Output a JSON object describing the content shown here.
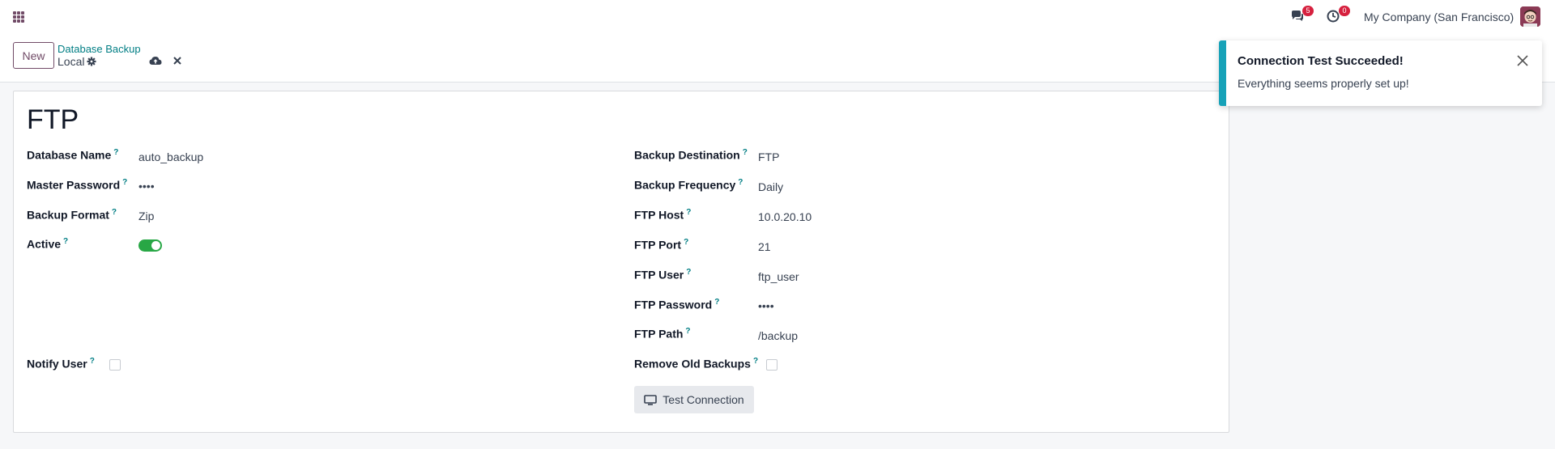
{
  "navbar": {
    "messages_badge": "5",
    "activities_badge": "0",
    "company": "My Company (San Francisco)"
  },
  "control_panel": {
    "new_label": "New",
    "breadcrumb_parent": "Database Backup",
    "breadcrumb_current": "Local"
  },
  "form": {
    "title": "FTP",
    "left_fields": [
      {
        "label": "Database Name",
        "value": "auto_backup"
      },
      {
        "label": "Master Password",
        "value": "••••"
      },
      {
        "label": "Backup Format",
        "value": "Zip"
      },
      {
        "label": "Active",
        "value": "on"
      },
      {
        "label": "Notify User",
        "value": "unchecked"
      }
    ],
    "right_fields": [
      {
        "label": "Backup Destination",
        "value": "FTP"
      },
      {
        "label": "Backup Frequency",
        "value": "Daily"
      },
      {
        "label": "FTP Host",
        "value": "10.0.20.10"
      },
      {
        "label": "FTP Port",
        "value": "21"
      },
      {
        "label": "FTP User",
        "value": "ftp_user"
      },
      {
        "label": "FTP Password",
        "value": "••••"
      },
      {
        "label": "FTP Path",
        "value": "/backup"
      },
      {
        "label": "Remove Old Backups",
        "value": "unchecked"
      }
    ],
    "help_mark": "?",
    "test_button_label": "Test Connection"
  },
  "notification": {
    "title": "Connection Test Succeeded!",
    "message": "Everything seems properly set up!"
  },
  "colors": {
    "brand": "#714b67",
    "link": "#017e84",
    "toggle_on": "#28a745",
    "badge": "#d6203e",
    "notification_accent": "#17a2b8"
  },
  "icons": [
    "apps-grid-icon",
    "chat-icon",
    "clock-icon",
    "gear-icon",
    "cloud-upload-icon",
    "close-icon",
    "monitor-icon"
  ]
}
